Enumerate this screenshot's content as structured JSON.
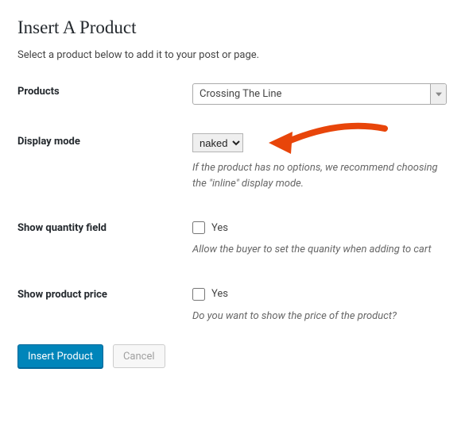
{
  "header": {
    "title": "Insert A Product",
    "subtitle": "Select a product below to add it to your post or page."
  },
  "fields": {
    "products": {
      "label": "Products",
      "selected": "Crossing The Line"
    },
    "display_mode": {
      "label": "Display mode",
      "selected": "naked",
      "hint": "If the product has no options, we recommend choosing the \"inline\" display mode."
    },
    "show_quantity": {
      "label": "Show quantity field",
      "option_label": "Yes",
      "checked": false,
      "hint": "Allow the buyer to set the quanity when adding to cart"
    },
    "show_price": {
      "label": "Show product price",
      "option_label": "Yes",
      "checked": false,
      "hint": "Do you want to show the price of the product?"
    }
  },
  "buttons": {
    "insert": "Insert Product",
    "cancel": "Cancel"
  },
  "annotation": {
    "arrow_color": "#e8450a"
  }
}
